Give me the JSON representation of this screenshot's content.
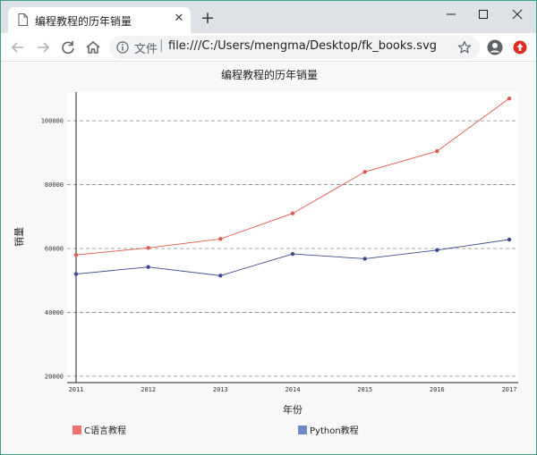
{
  "browser": {
    "tab_title": "编程教程的历年销量",
    "new_tab_symbol": "+",
    "close_symbol": "✕",
    "omnibox_scheme": "文件",
    "omnibox_separator": "|",
    "url": "file:///C:/Users/mengma/Desktop/fk_books.svg",
    "icons": [
      "page-icon",
      "close-icon",
      "plus-icon",
      "minimize-icon",
      "maximize-icon",
      "window-close-icon",
      "back-icon",
      "forward-icon",
      "reload-icon",
      "home-icon",
      "info-icon",
      "star-icon",
      "account-icon",
      "extension-icon"
    ]
  },
  "chart_data": {
    "type": "line",
    "title": "编程教程的历年销量",
    "xlabel": "年份",
    "ylabel": "销量",
    "categories": [
      "2011",
      "2012",
      "2013",
      "2014",
      "2015",
      "2016",
      "2017"
    ],
    "yticks": [
      20000,
      40000,
      60000,
      80000,
      100000
    ],
    "ylim": [
      18000,
      109000
    ],
    "grid": "horizontal dashed",
    "legend_position": "bottom",
    "series": [
      {
        "name": "C语言教程",
        "color": "#e0584e",
        "values": [
          58000,
          60200,
          63000,
          71000,
          84000,
          90500,
          107000
        ]
      },
      {
        "name": "Python教程",
        "color": "#3f4b8c",
        "values": [
          52000,
          54200,
          51500,
          58300,
          56800,
          59500,
          62800
        ]
      }
    ],
    "legend_colors": [
      "#f07070",
      "#6f88c6"
    ]
  }
}
